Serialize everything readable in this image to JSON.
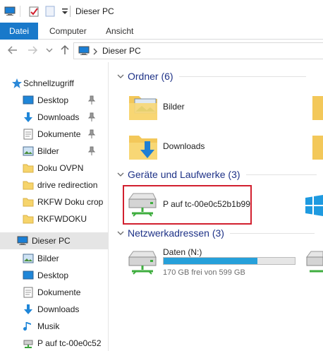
{
  "window": {
    "title": "Dieser PC"
  },
  "ribbon": {
    "tabs": [
      "Datei",
      "Computer",
      "Ansicht"
    ]
  },
  "address": {
    "path": "Dieser PC"
  },
  "navpane": {
    "quick_access": "Schnellzugriff",
    "quick_items": [
      {
        "label": "Desktop",
        "icon": "desktop-icon",
        "pinned": true
      },
      {
        "label": "Downloads",
        "icon": "downloads-icon",
        "pinned": true
      },
      {
        "label": "Dokumente",
        "icon": "documents-icon",
        "pinned": true
      },
      {
        "label": "Bilder",
        "icon": "pictures-icon",
        "pinned": true
      },
      {
        "label": "Doku OVPN",
        "icon": "folder-icon",
        "pinned": false
      },
      {
        "label": "drive redirection",
        "icon": "folder-icon",
        "pinned": false
      },
      {
        "label": "RKFW Doku crop",
        "icon": "folder-icon",
        "pinned": false
      },
      {
        "label": "RKFWDOKU",
        "icon": "folder-icon",
        "pinned": false
      }
    ],
    "this_pc": "Dieser PC",
    "pc_items": [
      {
        "label": "Bilder",
        "icon": "pictures-icon"
      },
      {
        "label": "Desktop",
        "icon": "desktop-icon"
      },
      {
        "label": "Dokumente",
        "icon": "documents-icon"
      },
      {
        "label": "Downloads",
        "icon": "downloads-icon"
      },
      {
        "label": "Musik",
        "icon": "music-icon"
      },
      {
        "label": "P auf tc-00e0c52",
        "icon": "network-drive-icon"
      }
    ]
  },
  "content": {
    "folders_header": "Ordner (6)",
    "folders": [
      {
        "label": "Bilder",
        "icon": "pictures-folder-icon"
      },
      {
        "label": "Downloads",
        "icon": "downloads-folder-icon"
      }
    ],
    "devices_header": "Geräte und Laufwerke (3)",
    "devices": [
      {
        "label": "P auf tc-00e0c52b1b99",
        "icon": "network-drive-icon"
      }
    ],
    "network_header": "Netzwerkadressen (3)",
    "network": [
      {
        "label": "Daten (N:)",
        "sub": "170 GB frei von 599 GB",
        "used_fraction": 0.716,
        "icon": "network-drive-icon"
      }
    ]
  },
  "colors": {
    "accent": "#1979ca",
    "highlight_box": "#d2202f",
    "group_title": "#1e3287",
    "usage_bar": "#26a0da"
  }
}
